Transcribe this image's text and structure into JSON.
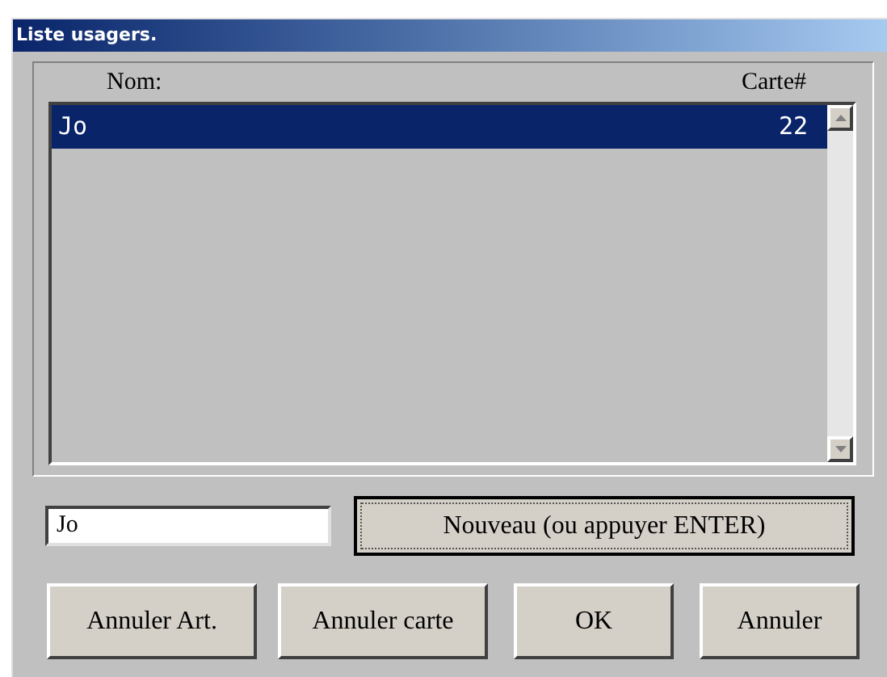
{
  "window": {
    "title": "Liste usagers."
  },
  "list": {
    "columns": [
      "Nom:",
      "Carte#"
    ],
    "rows": [
      {
        "name": "Jo",
        "card": "22",
        "selected": true
      }
    ]
  },
  "name_field": {
    "value": "Jo"
  },
  "new_button": {
    "label": "Nouveau (ou appuyer ENTER)",
    "focused": true
  },
  "buttons": [
    "Annuler Art.",
    "Annuler carte",
    "OK",
    "Annuler"
  ]
}
